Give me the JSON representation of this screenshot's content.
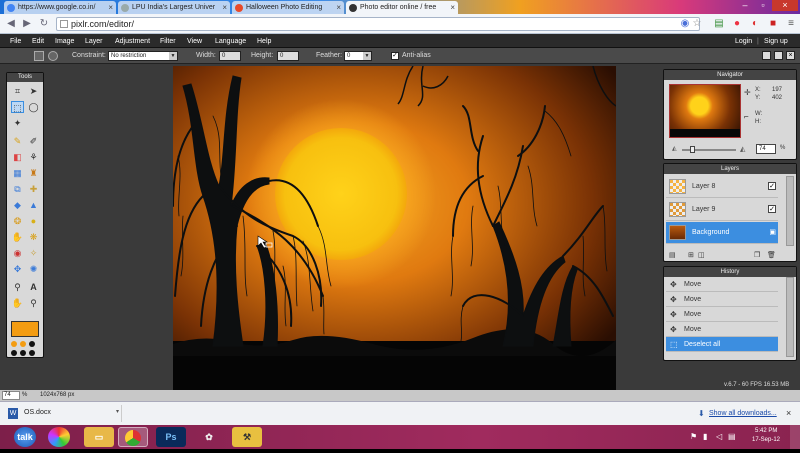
{
  "browser": {
    "tabs": [
      {
        "title": "https://www.google.co.in/"
      },
      {
        "title": "LPU India's Largest Univer"
      },
      {
        "title": "Halloween Photo Editing"
      },
      {
        "title": "Photo editor online / free"
      }
    ],
    "url": "pixlr.com/editor/"
  },
  "app": {
    "menu": [
      "File",
      "Edit",
      "Image",
      "Layer",
      "Adjustment",
      "Filter",
      "View",
      "Language",
      "Help"
    ],
    "auth": {
      "login": "Login",
      "signup": "Sign up"
    },
    "options": {
      "constraint_label": "Constraint:",
      "constraint_value": "No restriction",
      "width_label": "Width:",
      "width_value": "0",
      "height_label": "Height:",
      "height_value": "0",
      "feather_label": "Feather:",
      "feather_value": "0",
      "antialias_label": "Anti-alias",
      "antialias_checked": true
    },
    "tools_title": "Tools",
    "foreground_color": "#f39c12",
    "navigator": {
      "title": "Navigator",
      "x_label": "X:",
      "x_value": "197",
      "y_label": "Y:",
      "y_value": "402",
      "w_label": "W:",
      "h_label": "H:",
      "zoom": "74",
      "zoom_unit": "%"
    },
    "layers": {
      "title": "Layers",
      "items": [
        {
          "name": "Layer 8",
          "visible": true,
          "selected": false
        },
        {
          "name": "Layer 9",
          "visible": true,
          "selected": false
        },
        {
          "name": "Background",
          "visible": true,
          "selected": true
        }
      ]
    },
    "history": {
      "title": "History",
      "items": [
        "Move",
        "Move",
        "Move",
        "Move",
        "Deselect all"
      ]
    },
    "status": {
      "zoom": "74",
      "zoom_unit": "%",
      "size": "1024x768 px",
      "version": "v.6.7 - 60 FPS 16.53 MB"
    }
  },
  "downloads": {
    "file": "OS.docx",
    "show_all": "Show all downloads..."
  },
  "taskbar": {
    "icons": [
      "talk-icon",
      "picasa-icon",
      "explorer-icon",
      "chrome-icon",
      "photoshop-icon",
      "paint-icon",
      "tools-icon"
    ],
    "time": "5:42 PM",
    "date": "17-Sep-12"
  }
}
